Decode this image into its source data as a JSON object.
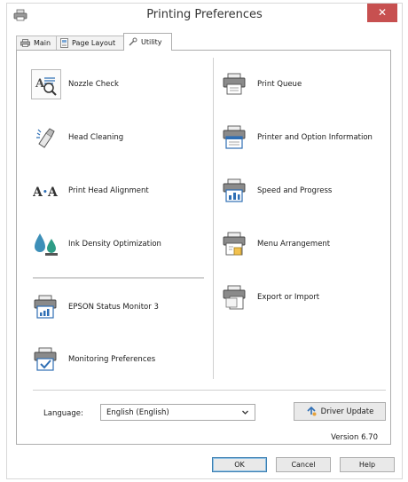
{
  "window": {
    "title": "Printing Preferences",
    "close_glyph": "✕"
  },
  "tabs": [
    {
      "label": "Main",
      "icon": "printer-icon"
    },
    {
      "label": "Page Layout",
      "icon": "page-layout-icon"
    },
    {
      "label": "Utility",
      "icon": "wrench-icon",
      "active": true
    }
  ],
  "left_items": [
    {
      "label": "Nozzle Check",
      "icon": "nozzle-check-icon"
    },
    {
      "label": "Head Cleaning",
      "icon": "head-cleaning-icon"
    },
    {
      "label": "Print Head Alignment",
      "icon": "print-head-alignment-icon"
    },
    {
      "label": "Ink Density Optimization",
      "icon": "ink-density-icon"
    },
    {
      "label": "EPSON Status Monitor 3",
      "icon": "status-monitor-icon"
    },
    {
      "label": "Monitoring Preferences",
      "icon": "monitoring-preferences-icon"
    }
  ],
  "right_items": [
    {
      "label": "Print Queue",
      "icon": "print-queue-icon"
    },
    {
      "label": "Printer and Option Information",
      "icon": "printer-info-icon"
    },
    {
      "label": "Speed and Progress",
      "icon": "speed-progress-icon"
    },
    {
      "label": "Menu Arrangement",
      "icon": "menu-arrangement-icon"
    },
    {
      "label": "Export or Import",
      "icon": "export-import-icon"
    }
  ],
  "language": {
    "label": "Language:",
    "selected": "English (English)"
  },
  "driver_update": {
    "label": "Driver Update"
  },
  "version": "Version 6.70",
  "buttons": {
    "ok": "OK",
    "cancel": "Cancel",
    "help": "Help"
  },
  "colors": {
    "close": "#c75050",
    "accent_blue": "#2f6fb5"
  }
}
